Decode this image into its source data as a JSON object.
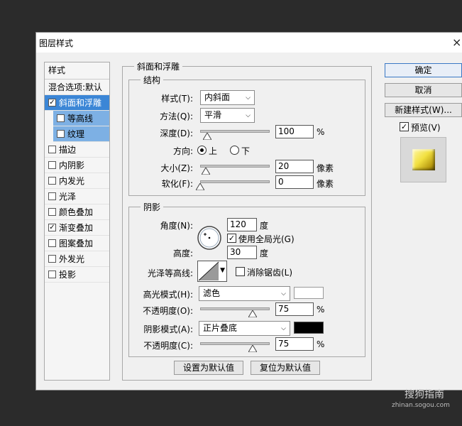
{
  "dialog": {
    "title": "图层样式",
    "close": "×"
  },
  "left_list": {
    "header": "样式",
    "blend_options": "混合选项:默认",
    "items": [
      {
        "label": "斜面和浮雕",
        "checked": "✓"
      },
      {
        "label": "等高线",
        "checked": ""
      },
      {
        "label": "纹理",
        "checked": ""
      },
      {
        "label": "描边",
        "checked": ""
      },
      {
        "label": "内阴影",
        "checked": ""
      },
      {
        "label": "内发光",
        "checked": ""
      },
      {
        "label": "光泽",
        "checked": ""
      },
      {
        "label": "颜色叠加",
        "checked": ""
      },
      {
        "label": "渐变叠加",
        "checked": "✓"
      },
      {
        "label": "图案叠加",
        "checked": ""
      },
      {
        "label": "外发光",
        "checked": ""
      },
      {
        "label": "投影",
        "checked": ""
      }
    ]
  },
  "bevel": {
    "section_title": "斜面和浮雕",
    "structure_title": "结构",
    "style_label": "样式(T):",
    "style_value": "内斜面",
    "method_label": "方法(Q):",
    "method_value": "平滑",
    "depth_label": "深度(D):",
    "depth_value": "100",
    "depth_unit": "%",
    "depth_fraction": 0.1,
    "direction_label": "方向:",
    "direction_up": "上",
    "direction_down": "下",
    "size_label": "大小(Z):",
    "size_value": "20",
    "size_unit": "像素",
    "size_fraction": 0.08,
    "soften_label": "软化(F):",
    "soften_value": "0",
    "soften_unit": "像素",
    "soften_fraction": 0.0
  },
  "shading": {
    "title": "阴影",
    "angle_label": "角度(N):",
    "angle_value": "120",
    "angle_unit": "度",
    "global_light_check": "✓",
    "global_light_label": "使用全局光(G)",
    "altitude_label": "高度:",
    "altitude_value": "30",
    "altitude_unit": "度",
    "gloss_label": "光泽等高线:",
    "antialias_label": "消除锯齿(L)",
    "highlight_mode_label": "高光模式(H):",
    "highlight_mode_value": "滤色",
    "highlight_color": "#ffffff",
    "highlight_opacity_label": "不透明度(O):",
    "highlight_opacity_value": "75",
    "highlight_opacity_unit": "%",
    "highlight_opacity_fraction": 0.75,
    "shadow_mode_label": "阴影模式(A):",
    "shadow_mode_value": "正片叠底",
    "shadow_color": "#000000",
    "shadow_opacity_label": "不透明度(C):",
    "shadow_opacity_value": "75",
    "shadow_opacity_unit": "%",
    "shadow_opacity_fraction": 0.75
  },
  "bottom_buttons": {
    "set_default": "设置为默认值",
    "reset_default": "复位为默认值"
  },
  "right_panel": {
    "ok": "确定",
    "cancel": "取消",
    "new_style": "新建样式(W)...",
    "preview_check": "✓",
    "preview_label": "预览(V)"
  },
  "watermark": {
    "brand": "搜狗指南",
    "url": "zhinan.sogou.com"
  }
}
